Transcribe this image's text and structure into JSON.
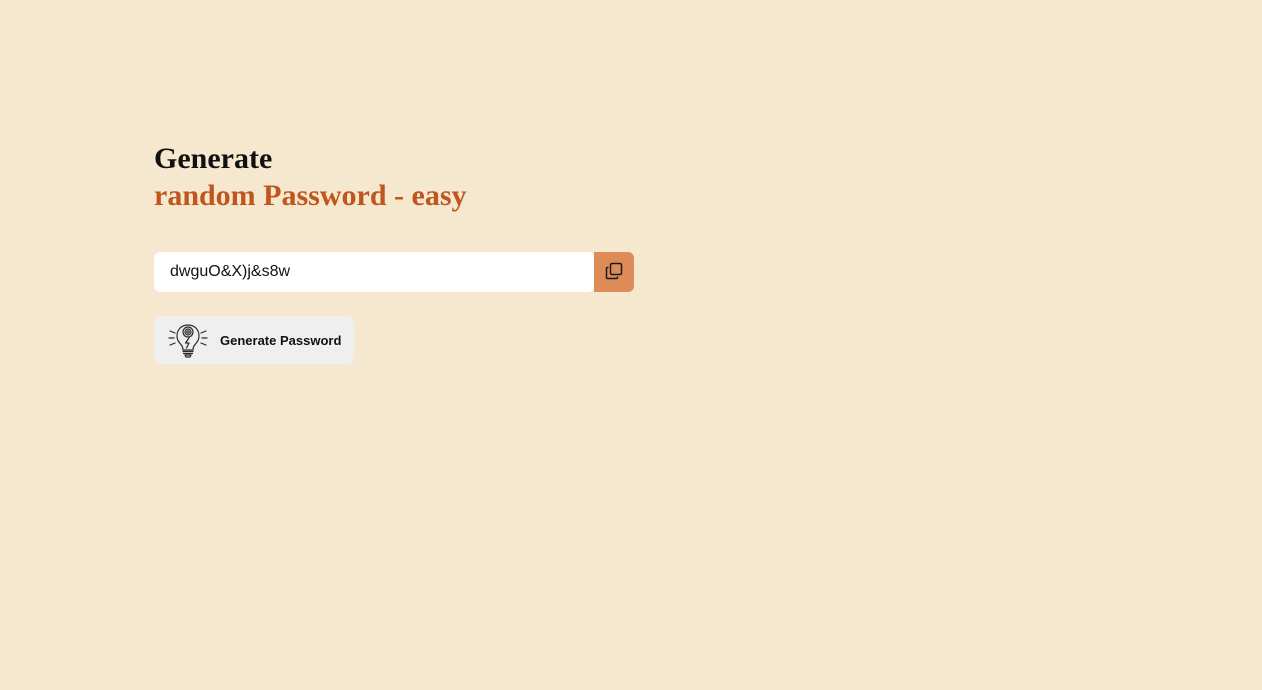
{
  "heading": {
    "line1": "Generate",
    "line2": "random Password - easy"
  },
  "password_field": {
    "value": "dwguO&X)j&s8w"
  },
  "copy_button": {
    "icon": "copy-icon"
  },
  "generate_button": {
    "label": "Generate Password",
    "icon": "lightbulb-icon"
  },
  "colors": {
    "background": "#f5e8ce",
    "accent_text": "#c0561d",
    "copy_button_bg": "#de8c57",
    "generate_button_bg": "#efefef"
  }
}
